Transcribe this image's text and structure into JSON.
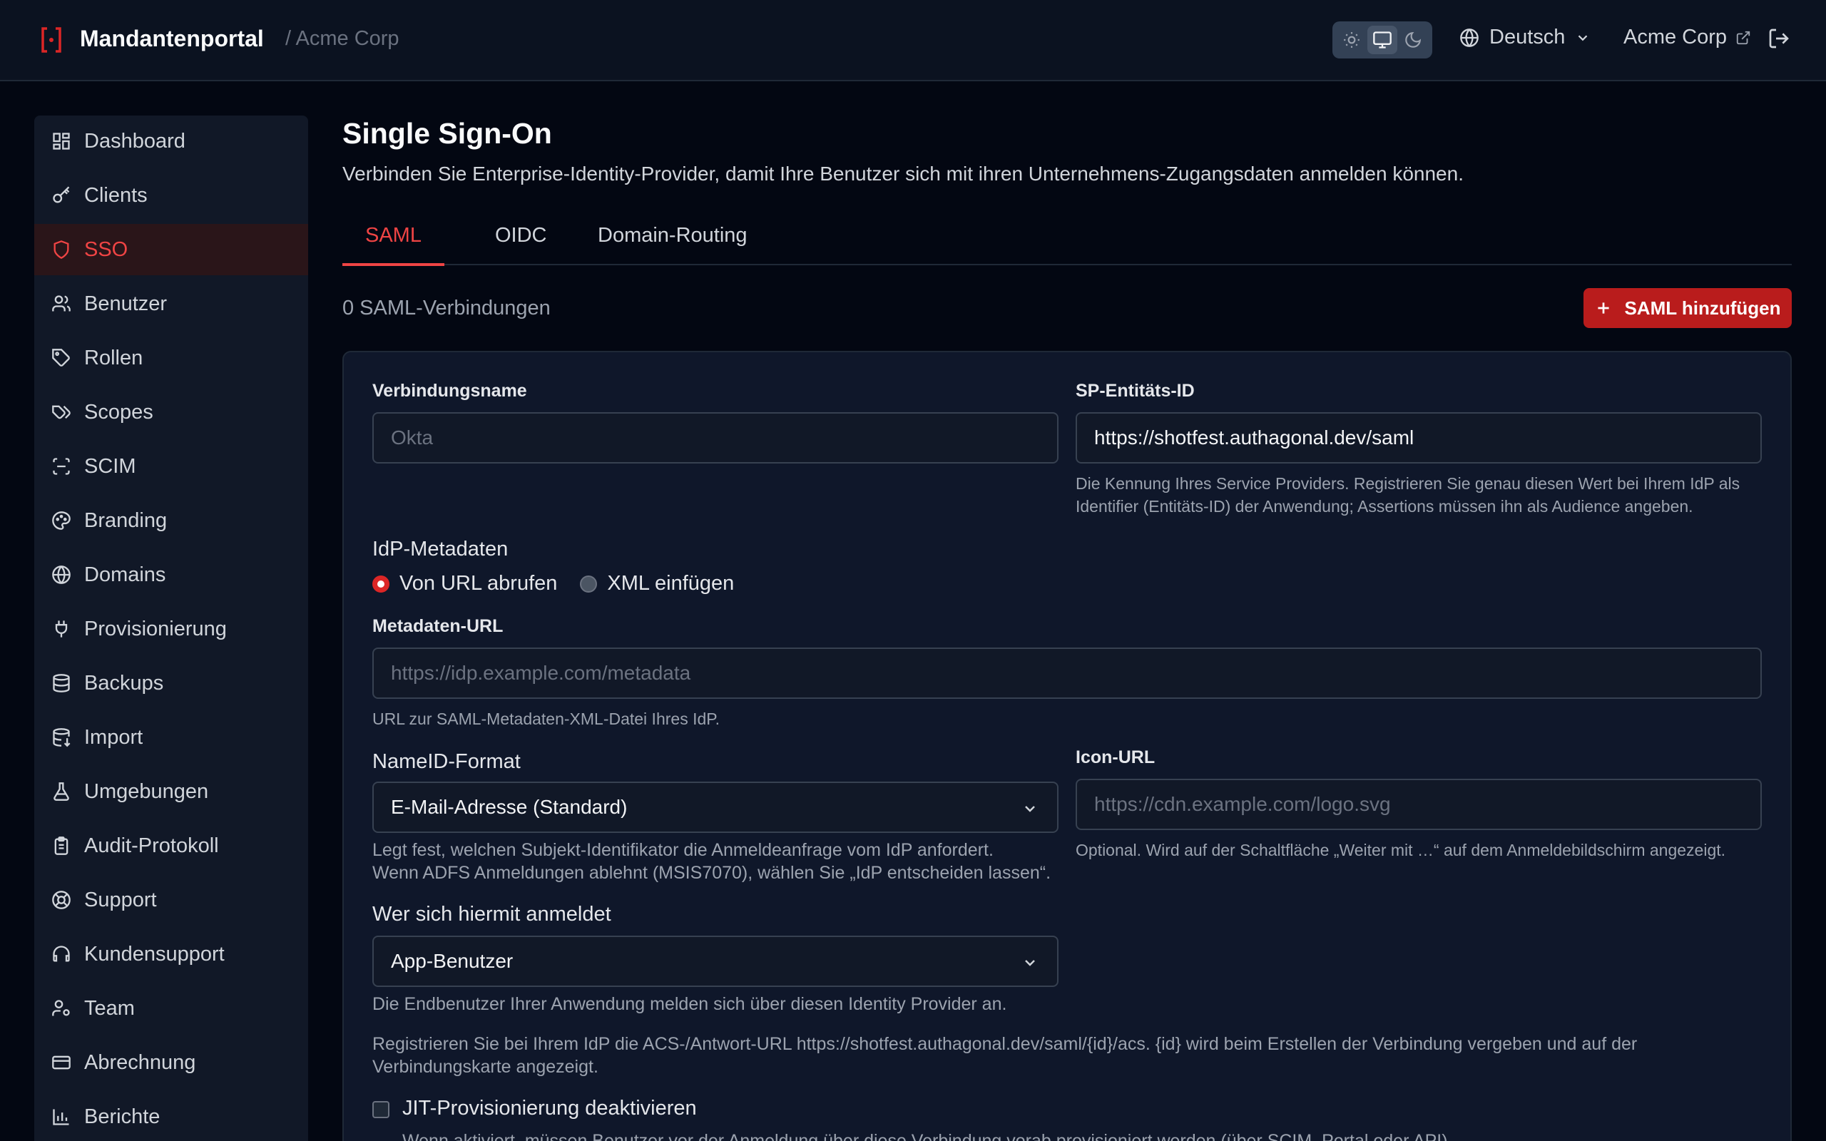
{
  "app": {
    "title": "Mandantenportal",
    "breadcrumb": "/ Acme Corp"
  },
  "header": {
    "language": "Deutsch",
    "tenant": "Acme Corp",
    "theme_options": [
      "sun-icon",
      "monitor-icon",
      "moon-icon"
    ],
    "theme_selected": "monitor-icon"
  },
  "sidebar": {
    "items": [
      {
        "label": "Dashboard",
        "icon": "dashboard-icon"
      },
      {
        "label": "Clients",
        "icon": "key-icon"
      },
      {
        "label": "SSO",
        "icon": "shield-icon",
        "active": true
      },
      {
        "label": "Benutzer",
        "icon": "users-icon"
      },
      {
        "label": "Rollen",
        "icon": "tag-icon"
      },
      {
        "label": "Scopes",
        "icon": "tags-icon"
      },
      {
        "label": "SCIM",
        "icon": "scan-icon"
      },
      {
        "label": "Branding",
        "icon": "palette-icon"
      },
      {
        "label": "Domains",
        "icon": "globe-icon"
      },
      {
        "label": "Provisionierung",
        "icon": "plug-icon"
      },
      {
        "label": "Backups",
        "icon": "database-icon"
      },
      {
        "label": "Import",
        "icon": "database-import-icon"
      },
      {
        "label": "Umgebungen",
        "icon": "flask-icon"
      },
      {
        "label": "Audit-Protokoll",
        "icon": "clipboard-icon"
      },
      {
        "label": "Support",
        "icon": "lifebuoy-icon"
      },
      {
        "label": "Kundensupport",
        "icon": "headset-icon"
      },
      {
        "label": "Team",
        "icon": "user-cog-icon"
      },
      {
        "label": "Abrechnung",
        "icon": "credit-card-icon"
      },
      {
        "label": "Berichte",
        "icon": "bar-chart-icon"
      }
    ]
  },
  "main": {
    "title": "Single Sign-On",
    "subtitle": "Verbinden Sie Enterprise-Identity-Provider, damit Ihre Benutzer sich mit ihren Unternehmens-Zugangsdaten anmelden können.",
    "tabs": [
      {
        "label": "SAML",
        "active": true
      },
      {
        "label": "OIDC"
      },
      {
        "label": "Domain-Routing"
      }
    ],
    "count": "0 SAML-Verbindungen",
    "add_button": "SAML hinzufügen"
  },
  "form": {
    "connection_name": {
      "label": "Verbindungsname",
      "placeholder": "Okta"
    },
    "sp_entity_id": {
      "label": "SP-Entitäts-ID",
      "value": "https://shotfest.authagonal.dev/saml",
      "help_line1": "Die Kennung Ihres Service Providers. Registrieren Sie genau diesen Wert bei Ihrem IdP als",
      "help_line2": "Identifier (Entitäts-ID) der Anwendung; Assertions müssen ihn als Audience angeben."
    },
    "idp_metadata": {
      "label": "IdP-Metadaten",
      "option_url": "Von URL abrufen",
      "option_xml": "XML einfügen",
      "selected": "Von URL abrufen"
    },
    "metadata_url": {
      "label": "Metadaten-URL",
      "placeholder": "https://idp.example.com/metadata",
      "help": "URL zur SAML-Metadaten-XML-Datei Ihres IdP."
    },
    "nameid_format": {
      "label": "NameID-Format",
      "value": "E-Mail-Adresse (Standard)",
      "help_line1": "Legt fest, welchen Subjekt-Identifikator die Anmeldeanfrage vom IdP anfordert.",
      "help_line2": "Wenn ADFS Anmeldungen ablehnt (MSIS7070), wählen Sie „IdP entscheiden lassen“."
    },
    "icon_url": {
      "label": "Icon-URL",
      "placeholder": "https://cdn.example.com/logo.svg",
      "help": "Optional. Wird auf der Schaltfläche „Weiter mit …“ auf dem Anmeldebildschirm angezeigt."
    },
    "who_signs_in": {
      "label": "Wer sich hiermit anmeldet",
      "value": "App-Benutzer",
      "help": "Die Endbenutzer Ihrer Anwendung melden sich über diesen Identity Provider an."
    },
    "acs_note_line1": "Registrieren Sie bei Ihrem IdP die ACS-/Antwort-URL https://shotfest.authagonal.dev/saml/{id}/acs. {id} wird beim Erstellen der Verbindung vergeben und auf der",
    "acs_note_line2": "Verbindungskarte angezeigt.",
    "jit": {
      "label": "JIT-Provisionierung deaktivieren",
      "help": "Wenn aktiviert, müssen Benutzer vor der Anmeldung über diese Verbindung vorab provisioniert werden (über SCIM, Portal oder API)."
    }
  },
  "colors": {
    "accent": "#dc2626",
    "background": "#030712",
    "panel": "#0f172a"
  }
}
